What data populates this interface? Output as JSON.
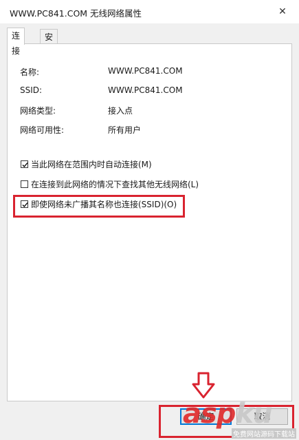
{
  "window": {
    "title": "WWW.PC841.COM 无线网络属性",
    "close_glyph": "✕"
  },
  "tabs": [
    {
      "label": "连接",
      "active": true
    },
    {
      "label": "安全",
      "active": false
    }
  ],
  "properties": [
    {
      "label": "名称:",
      "value": "WWW.PC841.COM"
    },
    {
      "label": "SSID:",
      "value": "WWW.PC841.COM"
    },
    {
      "label": "网络类型:",
      "value": "接入点"
    },
    {
      "label": "网络可用性:",
      "value": "所有用户"
    }
  ],
  "options": [
    {
      "label": "当此网络在范围内时自动连接(M)",
      "checked": true
    },
    {
      "label": "在连接到此网络的情况下查找其他无线网络(L)",
      "checked": false
    },
    {
      "label": "即使网络未广播其名称也连接(SSID)(O)",
      "checked": true
    }
  ],
  "buttons": {
    "ok": "确定",
    "cancel": "取消"
  },
  "watermark": {
    "main": "asp",
    "suffix": "ku",
    "sub": "免费网站源码下载站"
  },
  "colors": {
    "highlight": "#d9232f",
    "focus": "#0078d7"
  }
}
